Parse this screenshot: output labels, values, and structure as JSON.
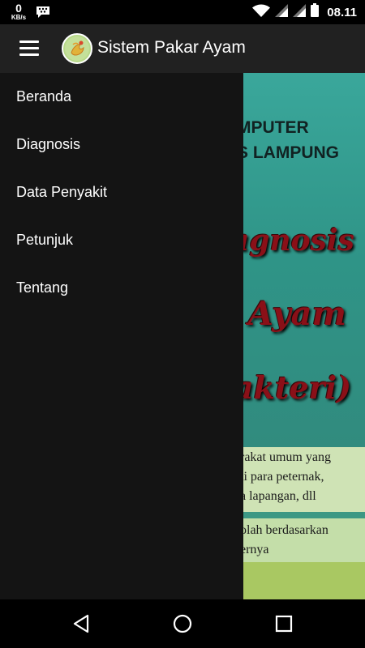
{
  "status_bar": {
    "net_speed_value": "0",
    "net_speed_unit": "KB/s",
    "time": "08.11",
    "icons": [
      "bbm-icon",
      "wifi-icon",
      "signal-icon",
      "signal-icon",
      "battery-icon"
    ]
  },
  "app_bar": {
    "title": "Sistem Pakar Ayam",
    "menu_icon": "hamburger-menu-icon",
    "logo_icon": "app-logo-icon"
  },
  "drawer": {
    "items": [
      {
        "label": "Beranda"
      },
      {
        "label": "Diagnosis"
      },
      {
        "label": "Data Penyakit"
      },
      {
        "label": "Petunjuk"
      },
      {
        "label": "Tentang"
      }
    ]
  },
  "background": {
    "heading_line1": "MPUTER",
    "heading_line2": "S LAMPUNG",
    "script_line1": "agnosis",
    "script_line2": "Ayam",
    "script_line3": "akteri)",
    "note1_line1": "rakat umum yang",
    "note1_line2": "ti para peternak,",
    "note1_line3": "a lapangan, dll",
    "note2_line1": "olah berdasarkan",
    "note2_line2": "ernya"
  },
  "nav_bar": {
    "icons": [
      "back-icon",
      "home-icon",
      "recents-icon"
    ]
  },
  "colors": {
    "app_bar": "#212121",
    "drawer": "#141414",
    "background_teal": "#2e8c83",
    "script_red": "#8a1018"
  }
}
